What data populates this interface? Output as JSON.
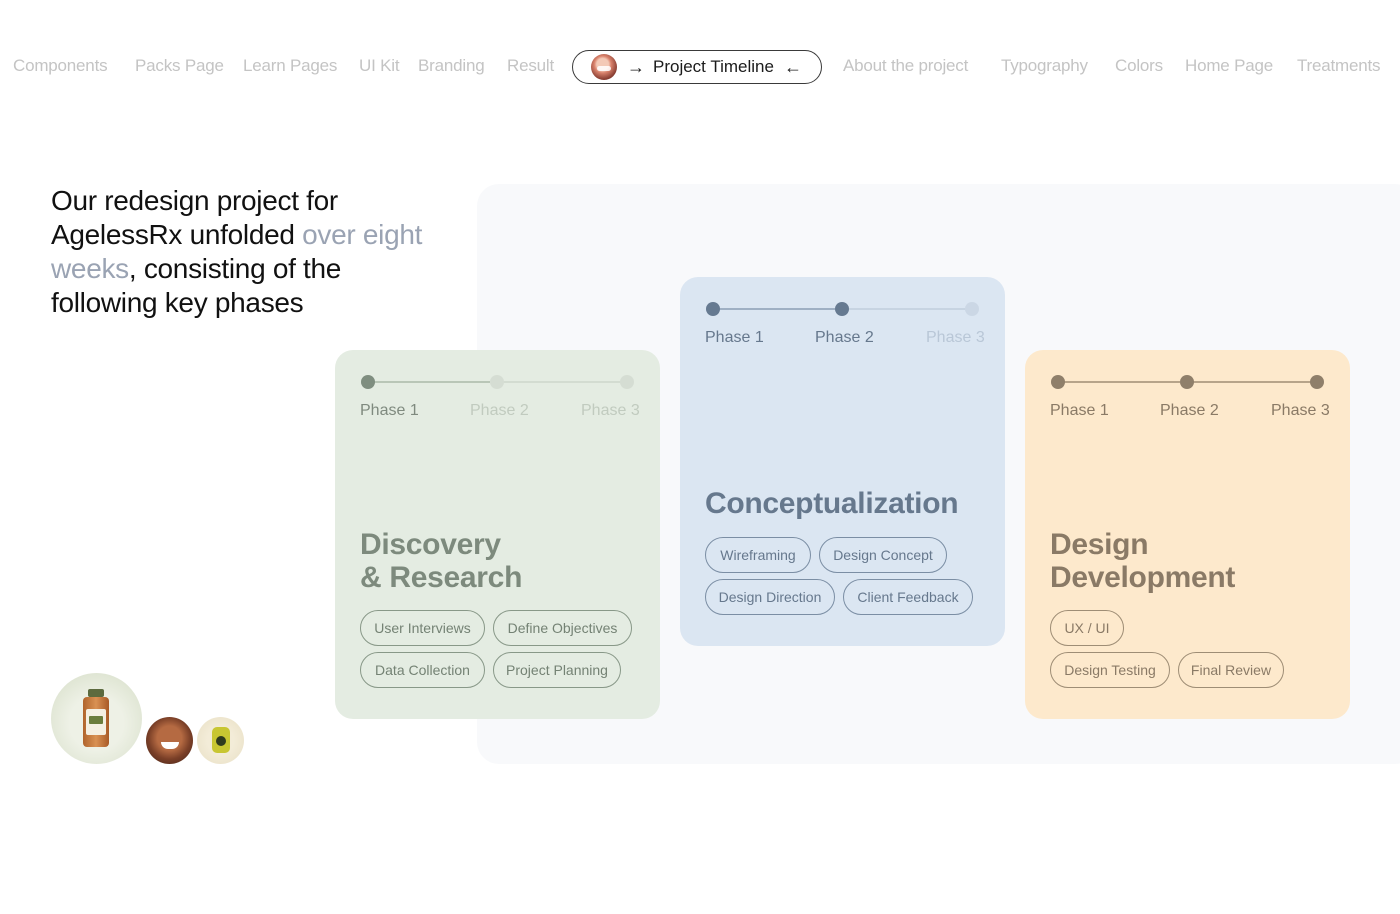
{
  "nav": {
    "items_left": [
      "Components",
      "Packs Page",
      "Learn Pages",
      "UI Kit",
      "Branding",
      "Result"
    ],
    "active": {
      "label": "Project Timeline",
      "arrow_right": "→",
      "arrow_left": "←"
    },
    "items_right": [
      "About the project",
      "Typography",
      "Colors",
      "Home Page",
      "Treatments"
    ]
  },
  "intro": {
    "part1": "Our redesign project for AgelessRx unfolded ",
    "highlight": "over eight weeks",
    "part2": ", consisting of the following key phases"
  },
  "cards": [
    {
      "id": "discovery",
      "phases": [
        "Phase 1",
        "Phase 2",
        "Phase 3"
      ],
      "active_phases": 1,
      "title_line1": "Discovery",
      "title_line2": "& Research",
      "tags": [
        "User Interviews",
        "Define Objectives",
        "Data Collection",
        "Project Planning"
      ],
      "color": "#e4ece2"
    },
    {
      "id": "conceptualization",
      "phases": [
        "Phase 1",
        "Phase 2",
        "Phase 3"
      ],
      "active_phases": 2,
      "title_line1": "Conceptualization",
      "title_line2": "",
      "tags": [
        "Wireframing",
        "Design Concept",
        "Design Direction",
        "Client Feedback"
      ],
      "color": "#dbe6f2"
    },
    {
      "id": "design-development",
      "phases": [
        "Phase 1",
        "Phase 2",
        "Phase 3"
      ],
      "active_phases": 3,
      "title_line1": "Design",
      "title_line2": "Development",
      "tags": [
        "UX / UI",
        "Design Testing",
        "Final Review"
      ],
      "color": "#fde9cc"
    }
  ]
}
